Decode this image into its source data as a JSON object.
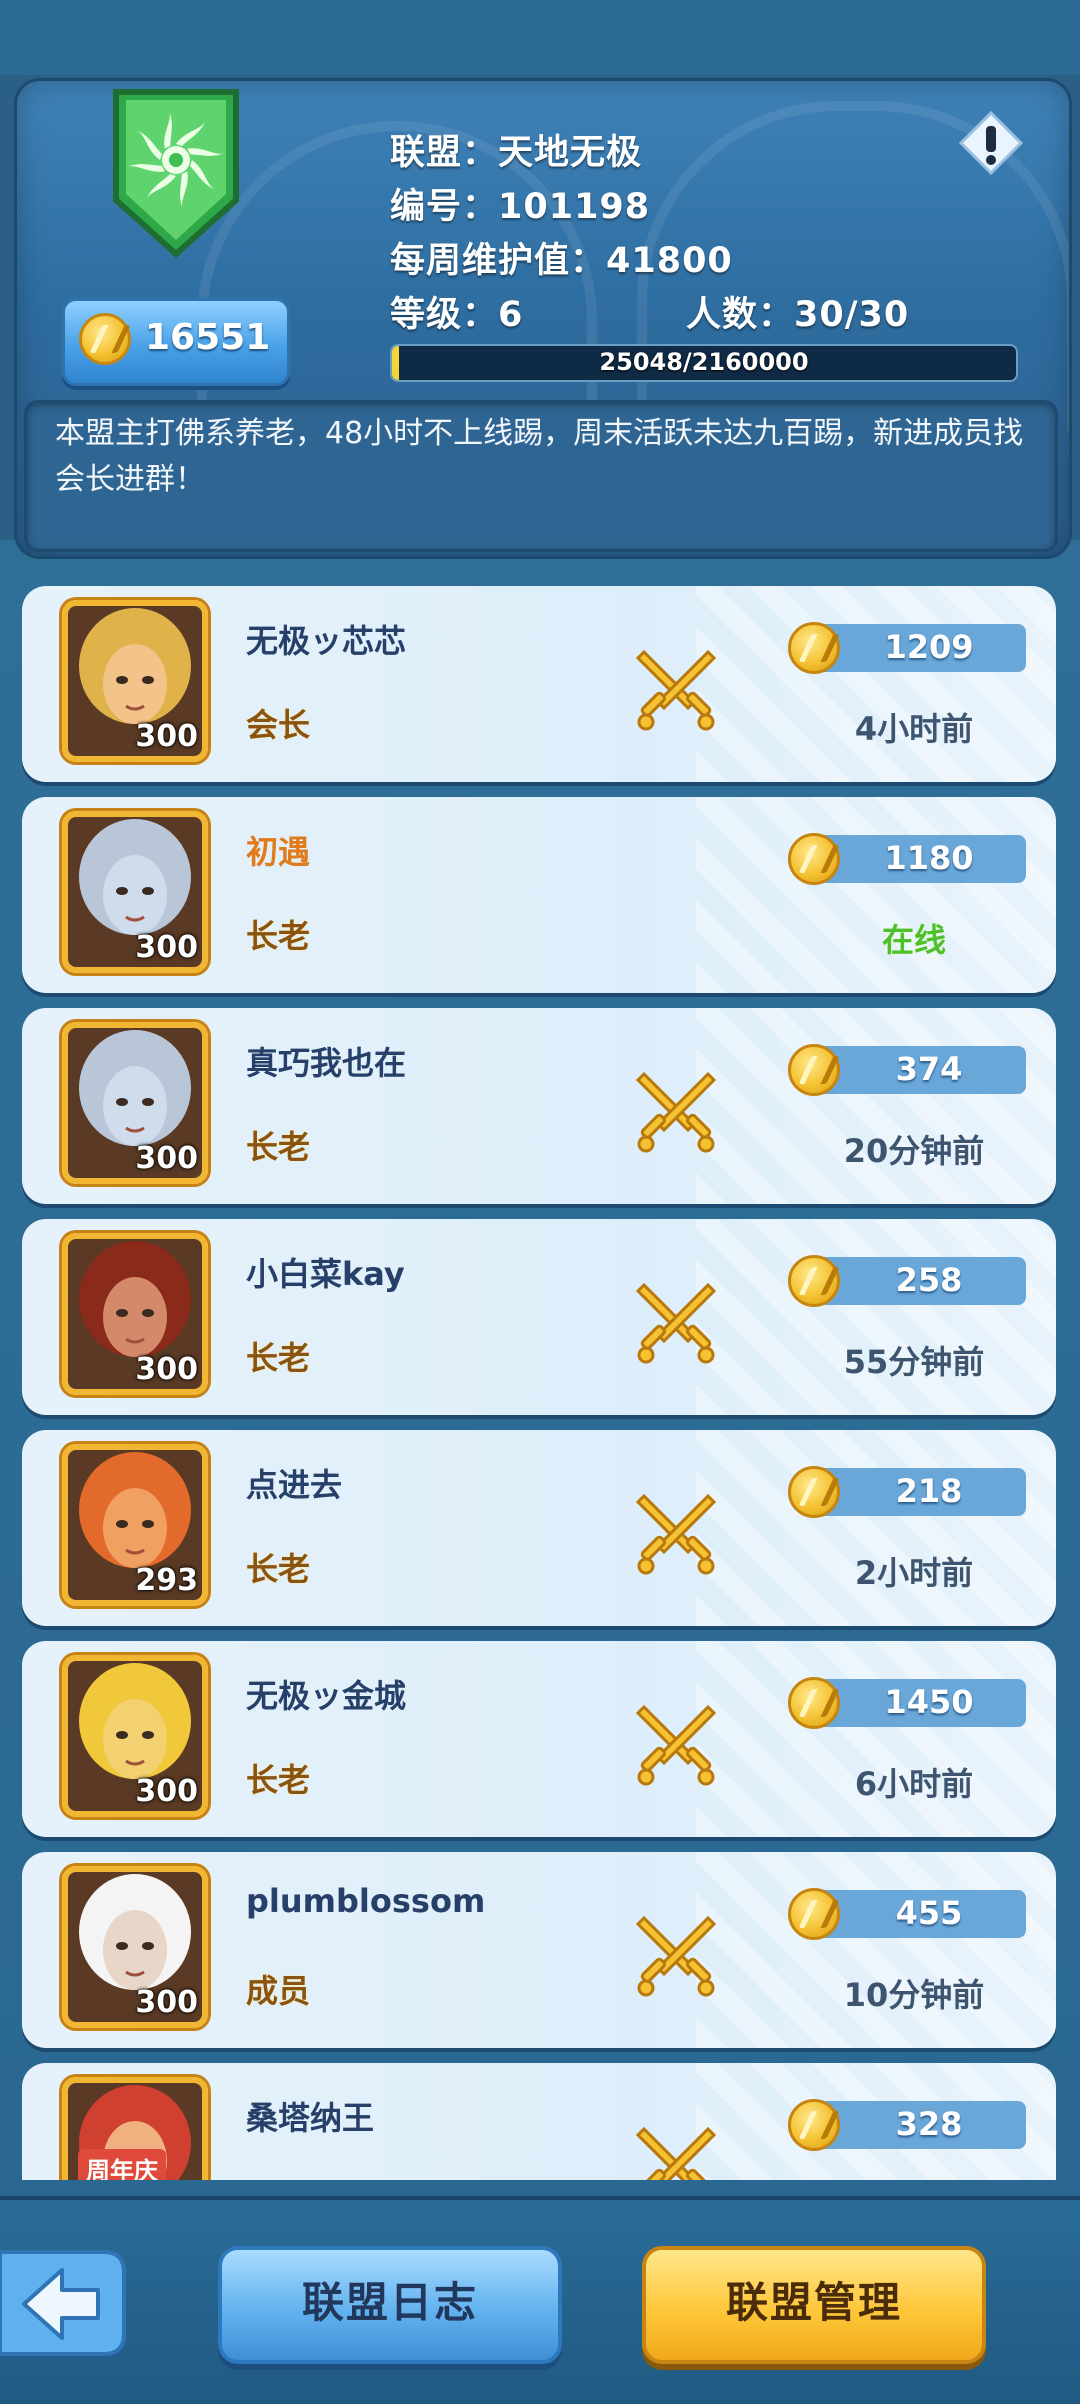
{
  "header": {
    "alliance_label": "联盟：",
    "alliance_name": "天地无极",
    "id_label": "编号：",
    "id_value": "101198",
    "weekly_label": "每周维护值：",
    "weekly_value": "41800",
    "level_label": "等级：",
    "level_value": "6",
    "members_label": "人数：",
    "members_value": "30/30",
    "coins": "16551",
    "progress_text": "25048/2160000",
    "progress_fraction": 0.0116,
    "notice": "本盟主打佛系养老，48小时不上线踢，周末活跃未达九百踢，新进成员找会长进群！"
  },
  "members": [
    {
      "name": "无极ッ芯芯",
      "role": "会长",
      "points": "1209",
      "status": "4小时前",
      "level": "300",
      "online": false,
      "name_color": "#26406a"
    },
    {
      "name": "初遇",
      "role": "长老",
      "points": "1180",
      "status": "在线",
      "level": "300",
      "online": true,
      "name_color": "#e07a1a"
    },
    {
      "name": "真巧我也在",
      "role": "长老",
      "points": "374",
      "status": "20分钟前",
      "level": "300",
      "online": false,
      "name_color": "#26406a"
    },
    {
      "name": "小白菜kay",
      "role": "长老",
      "points": "258",
      "status": "55分钟前",
      "level": "300",
      "online": false,
      "name_color": "#26406a"
    },
    {
      "name": "点进去",
      "role": "长老",
      "points": "218",
      "status": "2小时前",
      "level": "293",
      "online": false,
      "name_color": "#26406a"
    },
    {
      "name": "无极ッ金城",
      "role": "长老",
      "points": "1450",
      "status": "6小时前",
      "level": "300",
      "online": false,
      "name_color": "#26406a"
    },
    {
      "name": "plumblossom",
      "role": "成员",
      "points": "455",
      "status": "10分钟前",
      "level": "300",
      "online": false,
      "name_color": "#26406a"
    },
    {
      "name": "桑塔纳王",
      "role": "",
      "points": "328",
      "status": "",
      "level": "",
      "online": false,
      "name_color": "#26406a",
      "badge": "周年庆"
    }
  ],
  "bottom": {
    "log_label": "联盟日志",
    "manage_label": "联盟管理"
  },
  "icons": {
    "back": "back-arrow-icon",
    "alert": "exclamation-icon",
    "coin": "coin-icon",
    "swords": "crossed-swords-icon",
    "emblem": "alliance-emblem-icon"
  },
  "colors": {
    "online": "#4dc02b",
    "role": "#8a5410",
    "accent_gold": "#ffc73a",
    "accent_blue": "#63b2ef"
  }
}
